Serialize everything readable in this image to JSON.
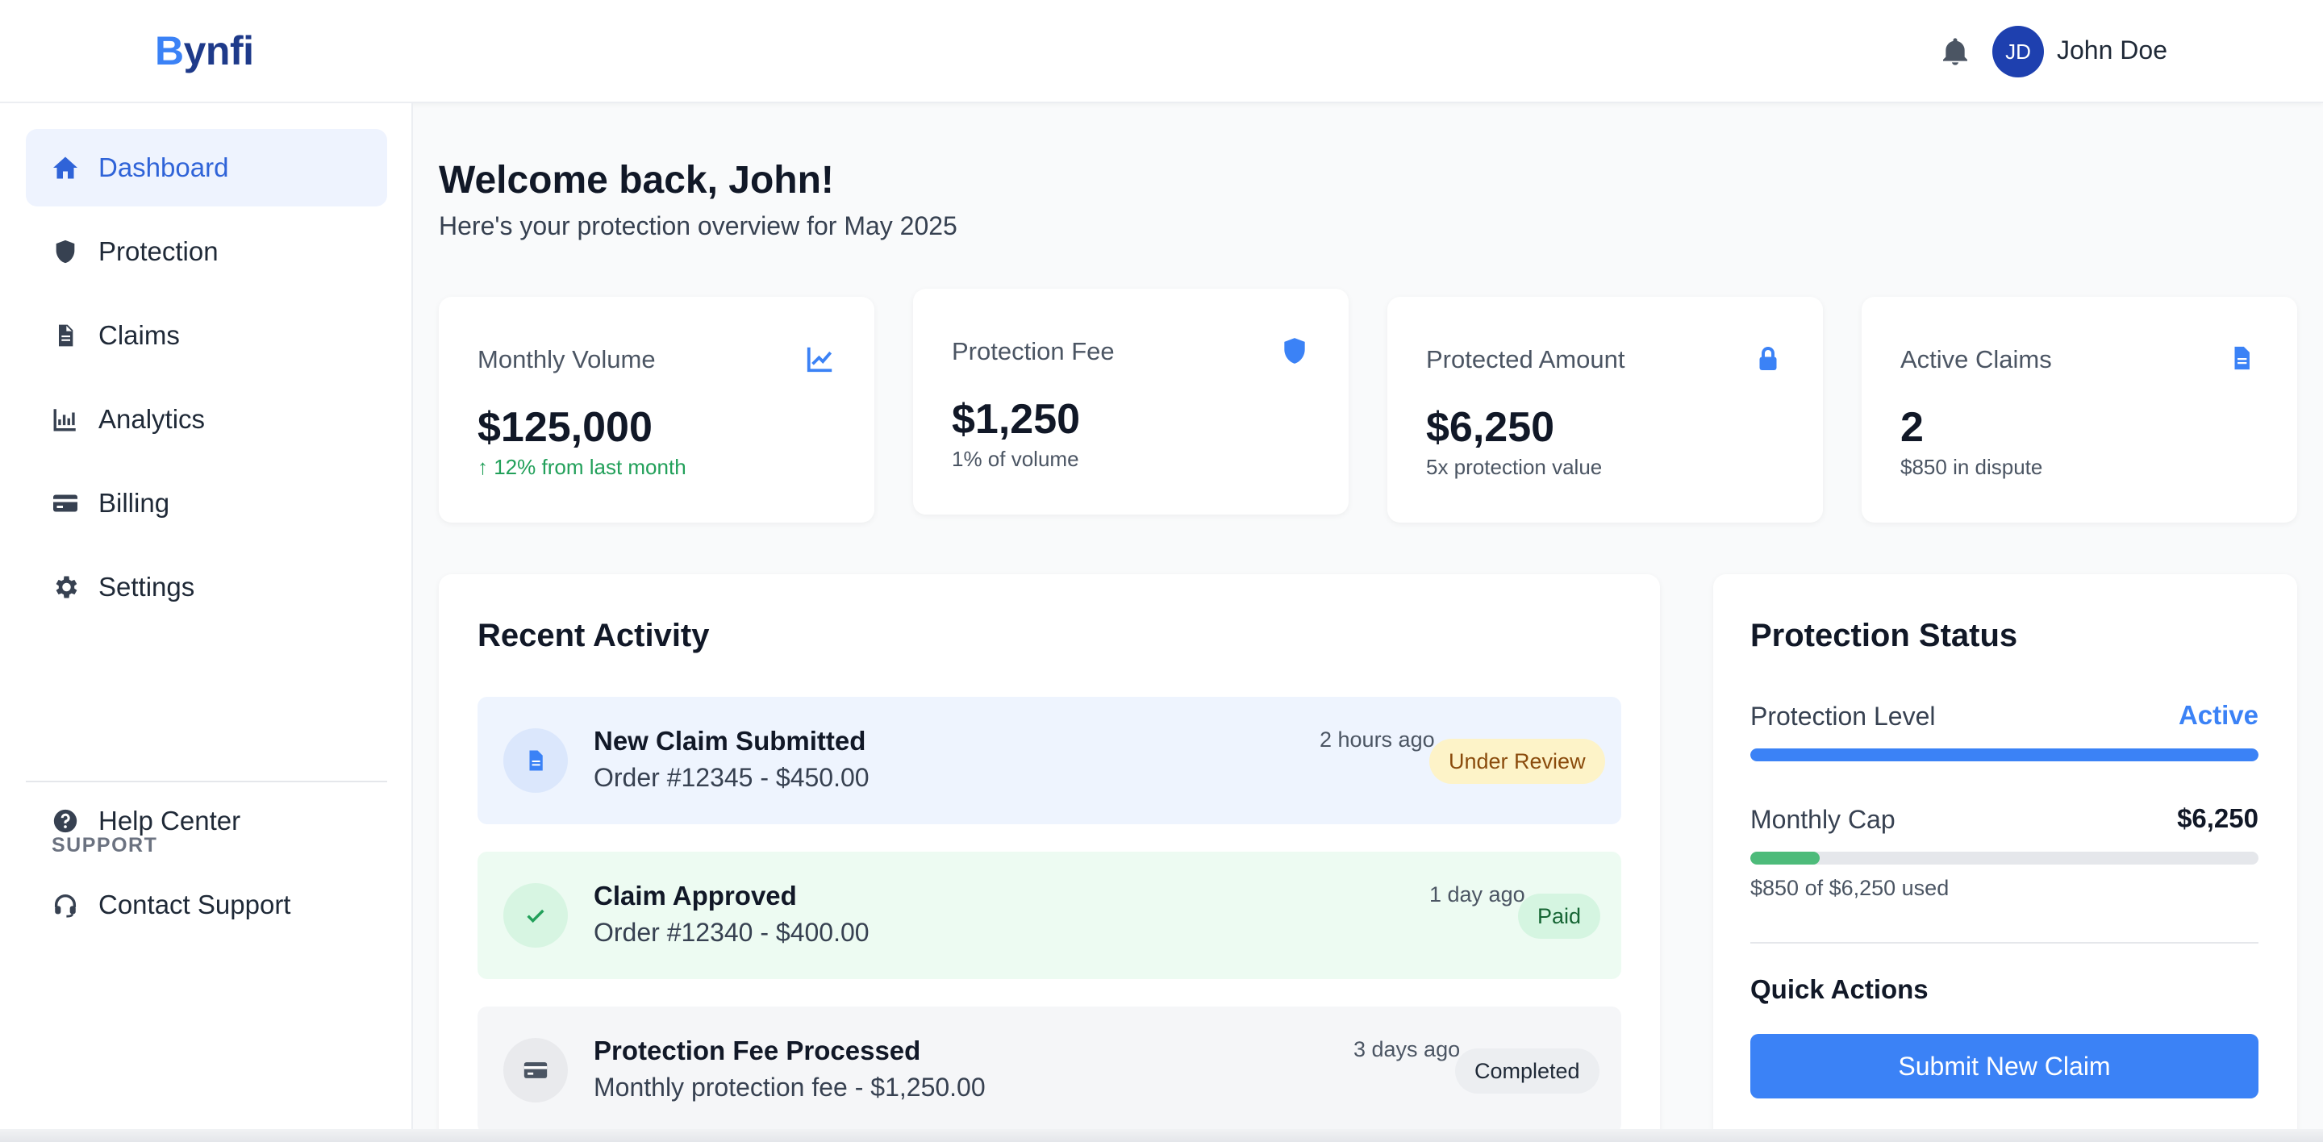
{
  "header": {
    "logo_first": "B",
    "logo_rest": "ynfi",
    "avatar_initials": "JD",
    "user_name": "John Doe"
  },
  "sidebar": {
    "items": [
      {
        "label": "Dashboard",
        "icon": "home-icon"
      },
      {
        "label": "Protection",
        "icon": "shield-icon"
      },
      {
        "label": "Claims",
        "icon": "document-icon"
      },
      {
        "label": "Analytics",
        "icon": "bar-chart-icon"
      },
      {
        "label": "Billing",
        "icon": "credit-card-icon"
      },
      {
        "label": "Settings",
        "icon": "gear-icon"
      }
    ],
    "support_heading": "SUPPORT",
    "support_items": [
      {
        "label": "Help Center",
        "icon": "question-circle-icon"
      },
      {
        "label": "Contact Support",
        "icon": "headset-icon"
      }
    ]
  },
  "main": {
    "welcome_title": "Welcome back, John!",
    "welcome_subtitle": "Here's your protection overview for May 2025",
    "stats": [
      {
        "title": "Monthly Volume",
        "value": "$125,000",
        "note": "↑ 12% from last month",
        "icon": "line-chart-icon"
      },
      {
        "title": "Protection Fee",
        "value": "$1,250",
        "note": "1% of volume",
        "icon": "shield-icon"
      },
      {
        "title": "Protected Amount",
        "value": "$6,250",
        "note": "5x protection value",
        "icon": "lock-icon"
      },
      {
        "title": "Active Claims",
        "value": "2",
        "note": "$850 in dispute",
        "icon": "document-icon"
      }
    ],
    "recent_activity": {
      "title": "Recent Activity",
      "items": [
        {
          "title": "New Claim Submitted",
          "subtitle": "Order #12345 - $450.00",
          "time": "2 hours ago",
          "badge": "Under Review",
          "icon": "document-icon"
        },
        {
          "title": "Claim Approved",
          "subtitle": "Order #12340 - $400.00",
          "time": "1 day ago",
          "badge": "Paid",
          "icon": "check-icon"
        },
        {
          "title": "Protection Fee Processed",
          "subtitle": "Monthly protection fee - $1,250.00",
          "time": "3 days ago",
          "badge": "Completed",
          "icon": "credit-card-icon"
        }
      ]
    },
    "protection_status": {
      "title": "Protection Status",
      "level_label": "Protection Level",
      "level_value": "Active",
      "level_progress": 1.0,
      "cap_label": "Monthly Cap",
      "cap_value": "$6,250",
      "cap_progress": 0.136,
      "cap_used_text": "$850 of $6,250 used",
      "quick_actions_title": "Quick Actions",
      "submit_button": "Submit New Claim"
    }
  },
  "colors": {
    "accent": "#3b82f6",
    "success": "#22a05a",
    "warning_bg": "#fdf3c8",
    "text": "#111827"
  }
}
